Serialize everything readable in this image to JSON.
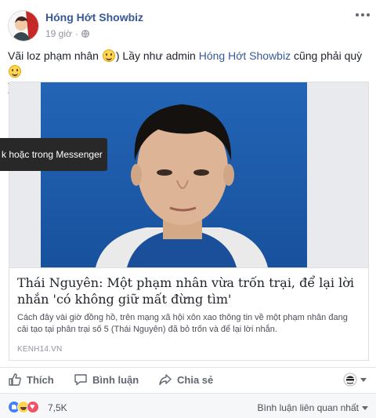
{
  "post": {
    "author": "Hóng Hớt Showbiz",
    "time": "19 giờ",
    "time_separator": "·",
    "privacy_icon": "globe-icon",
    "more_icon": "more-dots-icon",
    "text": {
      "part1": "Vãi loz phạm nhân ",
      "part2": ") Lầy như admin ",
      "mention": "Hóng Hớt Showbiz",
      "part3": " cũng phải quỳ ",
      "part4": ")"
    }
  },
  "link_card": {
    "title": "Thái Nguyên: Một phạm nhân vừa trốn trại, để lại lời nhắn 'có không giữ mất đừng tìm'",
    "description": "Cách đây vài giờ đồng hồ, trên mạng xã hội xôn xao thông tin về một phạm nhân đang cải tạo tại phân trại số 5 (Thái Nguyên) đã bỏ trốn và để lại lời nhắn.",
    "source": "KENH14.VN"
  },
  "tooltip": {
    "text": "k hoặc trong Messenger"
  },
  "actions": {
    "like": "Thích",
    "comment": "Bình luận",
    "share": "Chia sẻ"
  },
  "reactions": {
    "count": "7,5K",
    "types": [
      "like-icon",
      "haha-icon",
      "love-icon"
    ],
    "sort_label": "Bình luận liên quan nhất"
  },
  "colors": {
    "link": "#365899",
    "meta": "#90949c",
    "action": "#606770"
  }
}
